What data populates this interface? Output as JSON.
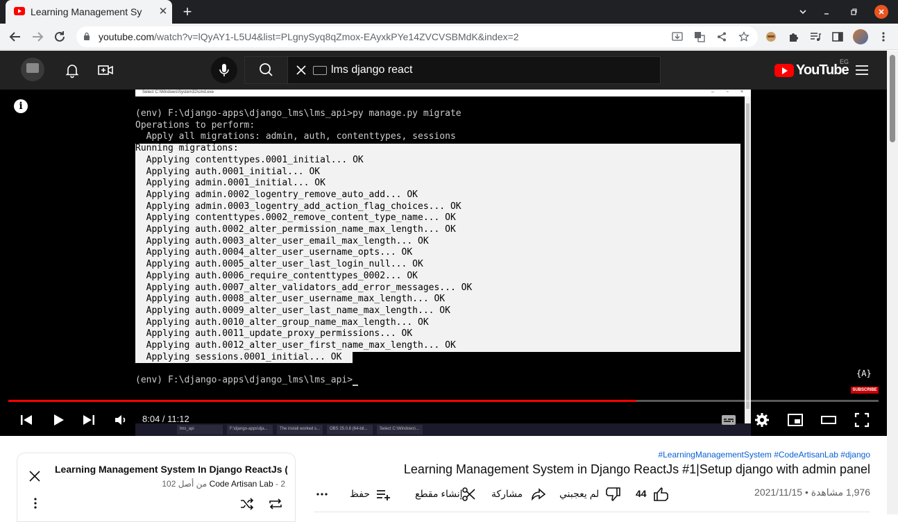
{
  "browser": {
    "tab_title": "Learning Management Sy",
    "tab_close": "✕",
    "new_tab": "+",
    "url_host": "youtube.com",
    "url_rest": "/watch?v=lQyAY1-L5U4&list=PLgnySyq8qZmox-EAyxkPYe14ZVCVSBMdK&index=2",
    "window_controls": [
      "minimize",
      "maximize",
      "close"
    ]
  },
  "masthead": {
    "search_query": "lms django react",
    "logo_text": "YouTube",
    "country_code": "EG",
    "icons": [
      "channel-logo",
      "bell-icon",
      "create-video-icon",
      "mic-icon",
      "search-icon",
      "clear-icon",
      "keyboard-icon",
      "menu-icon"
    ]
  },
  "player": {
    "console_window_title": "Select C:\\Windows\\System32\\cmd.exe",
    "lines_before": [
      "(env) F:\\django-apps\\django_lms\\lms_api>py manage.py migrate",
      "Operations to perform:",
      "  Apply all migrations: admin, auth, contenttypes, sessions"
    ],
    "lines_selected": [
      "Running migrations:",
      "  Applying contenttypes.0001_initial... OK",
      "  Applying auth.0001_initial... OK",
      "  Applying admin.0001_initial... OK",
      "  Applying admin.0002_logentry_remove_auto_add... OK",
      "  Applying admin.0003_logentry_add_action_flag_choices... OK",
      "  Applying contenttypes.0002_remove_content_type_name... OK",
      "  Applying auth.0002_alter_permission_name_max_length... OK",
      "  Applying auth.0003_alter_user_email_max_length... OK",
      "  Applying auth.0004_alter_user_username_opts... OK",
      "  Applying auth.0005_alter_user_last_login_null... OK",
      "  Applying auth.0006_require_contenttypes_0002... OK",
      "  Applying auth.0007_alter_validators_add_error_messages... OK",
      "  Applying auth.0008_alter_user_username_max_length... OK",
      "  Applying auth.0009_alter_user_last_name_max_length... OK",
      "  Applying auth.0010_alter_group_name_max_length... OK",
      "  Applying auth.0011_update_proxy_permissions... OK",
      "  Applying auth.0012_alter_user_first_name_max_length... OK",
      "  Applying sessions.0001_initial... OK"
    ],
    "prompt_line": "(env) F:\\django-apps\\django_lms\\lms_api>",
    "taskbar_items": [
      "lms_api",
      "F:\\django-apps\\dja...",
      "The install worked s...",
      "OBS 25.0.8 (64-bit...",
      "Select C:\\Windows\\..."
    ],
    "subscribe_label": "SUBSCRIBE",
    "subscribe_logo": "{A}",
    "time": "8:04 / 11:12",
    "progress": 0.722,
    "info_icon": "i"
  },
  "playlist": {
    "title": "Learning Management System In Django ReactJs (...",
    "channel": "Code Artisan Lab",
    "position": "- 2 من أصل 102"
  },
  "video": {
    "tags": "#LearningManagementSystem #CodeArtisanLab #django",
    "title": "Learning Management System in Django ReactJs #1|Setup django with admin panel",
    "meta": "1,976 مشاهدة • 2021/11/15",
    "likes": "44",
    "dislike_label": "لم يعجبني",
    "share_label": "مشاركة",
    "clip_label": "إنشاء مقطع",
    "save_label": "حفظ",
    "more_label": "..."
  },
  "colors": {
    "yt_red": "#ff0000",
    "progress_red": "#ff0000",
    "masthead_bg": "#222222",
    "link_blue": "#065fd4",
    "chrome_dark": "#202124"
  }
}
